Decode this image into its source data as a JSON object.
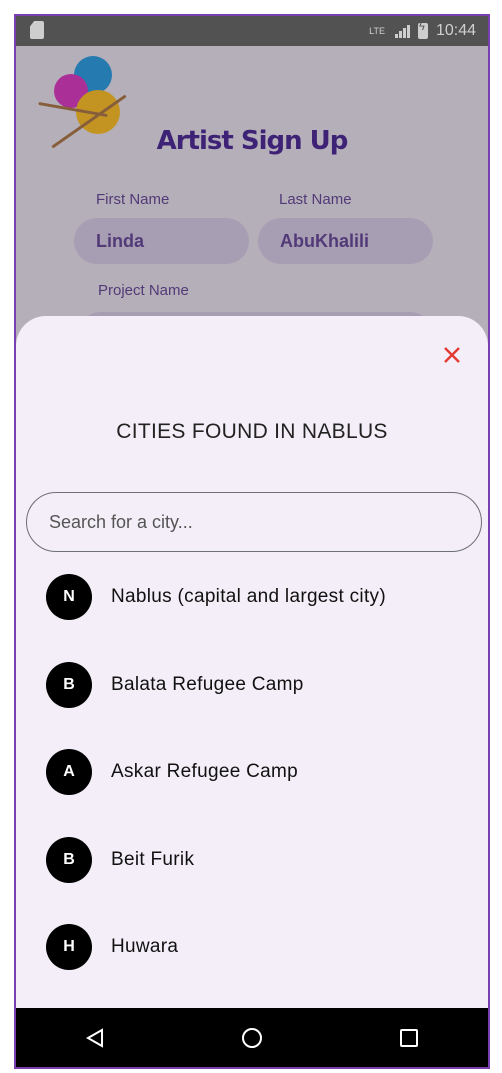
{
  "status_bar": {
    "time": "10:44",
    "network": "LTE"
  },
  "background_page": {
    "title": "Artist Sign Up",
    "first_name_label": "First Name",
    "first_name_value": "Linda",
    "last_name_label": "Last Name",
    "last_name_value": "AbuKhalili",
    "project_name_label": "Project Name"
  },
  "sheet": {
    "title": "CITIES FOUND IN NABLUS",
    "search_placeholder": "Search for a city...",
    "cities": [
      {
        "initial": "N",
        "name": "Nablus (capital and largest city)"
      },
      {
        "initial": "B",
        "name": "Balata Refugee Camp"
      },
      {
        "initial": "A",
        "name": "Askar Refugee Camp"
      },
      {
        "initial": "B",
        "name": "Beit Furik"
      },
      {
        "initial": "H",
        "name": "Huwara"
      }
    ]
  },
  "colors": {
    "close": "#e53935",
    "frame": "#7a3fb0",
    "title": "#3f1a8a"
  }
}
